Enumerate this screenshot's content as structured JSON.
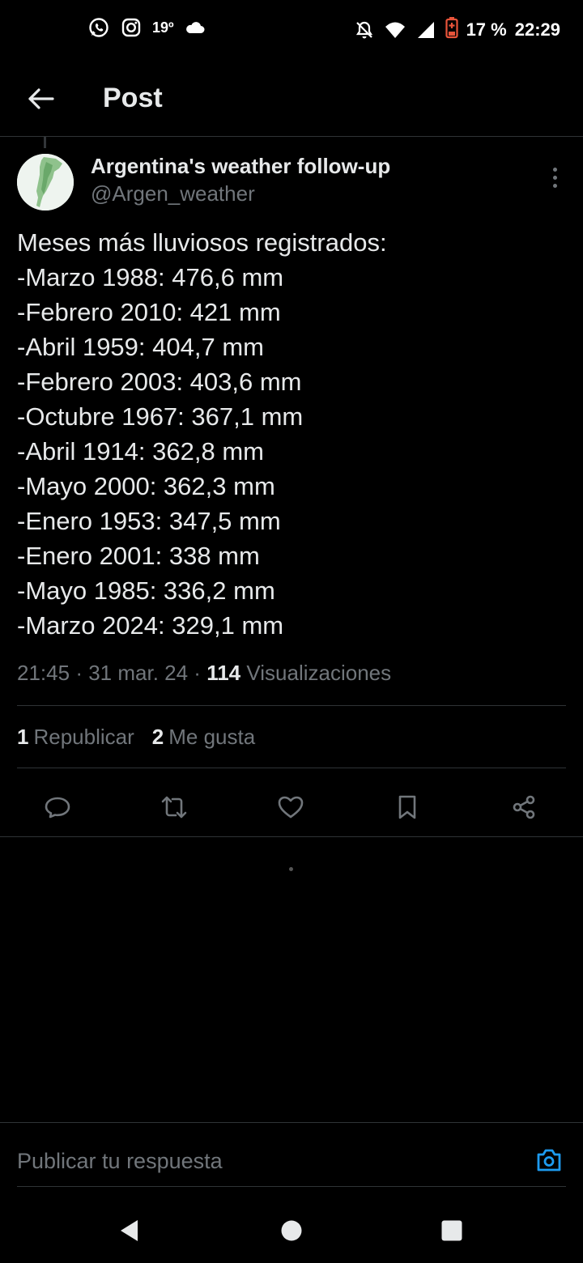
{
  "status_bar": {
    "temperature": "19º",
    "battery": "17 %",
    "time": "22:29",
    "icons_left": [
      "whatsapp-icon",
      "instagram-icon",
      "cloud-icon"
    ],
    "icons_right": [
      "notifications-off-icon",
      "wifi-icon",
      "signal-icon",
      "battery-low-icon"
    ]
  },
  "header": {
    "title": "Post"
  },
  "post": {
    "author_name": "Argentina's weather follow-up",
    "author_handle": "@Argen_weather",
    "lines": [
      "Meses más lluviosos registrados:",
      "-Marzo 1988: 476,6 mm",
      "-Febrero 2010: 421 mm",
      "-Abril 1959: 404,7 mm",
      "-Febrero 2003: 403,6 mm",
      "-Octubre 1967: 367,1 mm",
      "-Abril 1914: 362,8 mm",
      "-Mayo 2000: 362,3 mm",
      "-Enero 1953: 347,5 mm",
      "-Enero 2001: 338 mm",
      "-Mayo 1985: 336,2 mm",
      "-Marzo 2024: 329,1 mm"
    ],
    "time": "21:45",
    "date": "31 mar. 24",
    "views_count": "114",
    "views_label": "Visualizaciones",
    "reposts_count": "1",
    "reposts_label": "Republicar",
    "likes_count": "2",
    "likes_label": "Me gusta"
  },
  "reply": {
    "placeholder": "Publicar tu respuesta"
  },
  "colors": {
    "background": "#000000",
    "text": "#e7e9ea",
    "secondary": "#71767b",
    "accent": "#1d9bf0",
    "divider": "#2f3336"
  }
}
